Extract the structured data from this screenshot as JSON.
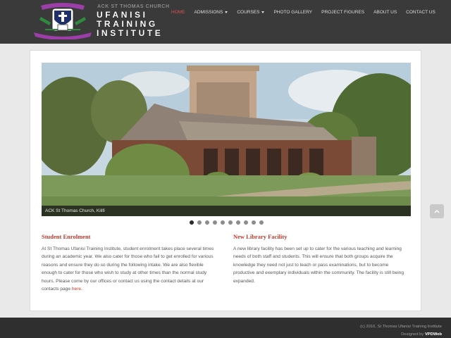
{
  "brand": {
    "top_text": "ACK ST THOMAS CHURCH",
    "line1": "UFANISI",
    "line2": "TRAINING",
    "line3": "INSTITUTE",
    "accent": "#c0392b",
    "crest_purple": "#9b3ea8",
    "crest_green": "#2e8b3e"
  },
  "nav": {
    "home": "HOME",
    "admissions": "ADMISSIONS",
    "courses": "COURSES",
    "gallery": "PHOTO GALLERY",
    "project": "PROJECT FIGURES",
    "about": "ABOUT US",
    "contact": "CONTACT US"
  },
  "slider": {
    "caption": "ACK St Thomas Church, Kilifi",
    "slide_count": 10,
    "active_index": 0
  },
  "enrolment": {
    "title": "Student Enrolment",
    "body": "At St Thomas Ufanisi Training Institute, student enrolment takes place several times during an academic year. We also cater for those who fail to get enrolled for various reasons and ensure they do so during the following intake. We are also flexible enough to cater for those who wish to study at other times than the normal study hours. Please come by our offices or contact us using the contact details at our contacts page ",
    "link": "here",
    "end": "."
  },
  "library": {
    "title": "New Library Facility",
    "body": "A new library facility has been set up to cater for the various teaching and learning needs of both staff and students. This will ensure that both groups acquire the knowledge they need not just to teach or pass examinations, but to become productive and exemplary individuals within the community. The facility is still being expanded."
  },
  "footer": {
    "copyright": "(c) 2016, St Thomas Ufanisi Training Institute",
    "designed_by": "Designed by",
    "designer": "VPDWeb"
  },
  "icons": {
    "scroll_top": "chevron-up-icon"
  }
}
